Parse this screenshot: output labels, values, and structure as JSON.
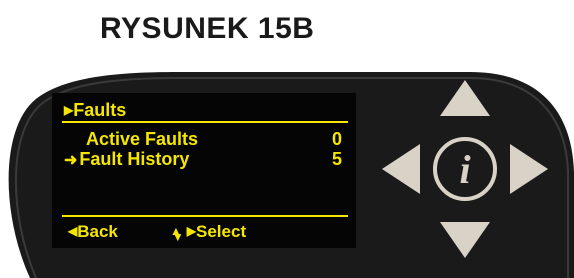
{
  "figure_label": "RYSUNEK 15B",
  "screen": {
    "menu_title": "Faults",
    "items": [
      {
        "label": "Active Faults",
        "value": "0",
        "selected": false
      },
      {
        "label": "Fault History",
        "value": "5",
        "selected": true
      }
    ],
    "softkeys": {
      "back": "Back",
      "select": "Select"
    },
    "text_color": "#f5e600",
    "background_color": "#050505"
  },
  "keypad": {
    "buttons": [
      "up-arrow",
      "down-arrow",
      "left-arrow",
      "right-arrow",
      "info"
    ],
    "info_label": "i",
    "button_color": "#d9d3c7",
    "bezel_color": "#1a1a1a"
  }
}
